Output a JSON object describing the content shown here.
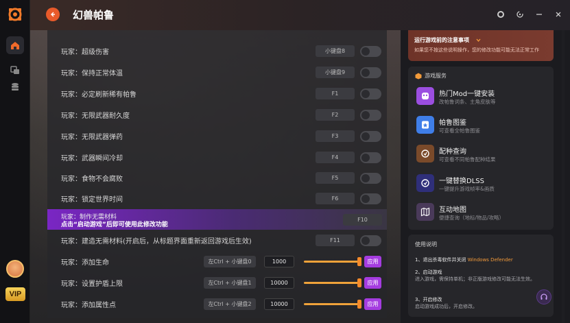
{
  "app": {
    "title": "幻兽帕鲁"
  },
  "colors": {
    "accent": "#e85a2a",
    "apply": "#a53ce0",
    "slider": "#f0a23a",
    "highlight": "#7a26c4"
  },
  "cheats": [
    {
      "label": "玩家：超级伤害",
      "key": "小键盘8"
    },
    {
      "label": "玩家：保持正常体温",
      "key": "小键盘9"
    },
    {
      "label": "玩家：必定刷新稀有帕鲁",
      "key": "F1"
    },
    {
      "label": "玩家：无限武器耐久度",
      "key": "F2"
    },
    {
      "label": "玩家：无限武器弹药",
      "key": "F3"
    },
    {
      "label": "玩家：武器瞬间冷却",
      "key": "F4"
    },
    {
      "label": "玩家：食物不会腐败",
      "key": "F5"
    },
    {
      "label": "玩家：锁定世界时间",
      "key": "F6"
    }
  ],
  "highlighted": {
    "label": "玩家：制作无需材料",
    "notice": "点击“启动游戏”后即可使用此修改功能",
    "key": "F10"
  },
  "build_row": {
    "label": "玩家：建造无需材料(开启后，从标题界面重新返回游戏后生效)",
    "key": "F11"
  },
  "value_rows": [
    {
      "label": "玩家：添加生命",
      "combo": "左Ctrl + 小键盘0",
      "value": "1000",
      "apply": "应用",
      "level": 1.0
    },
    {
      "label": "玩家：设置护盾上限",
      "combo": "左Ctrl + 小键盘1",
      "value": "10000",
      "apply": "应用",
      "level": 1.0
    },
    {
      "label": "玩家：添加属性点",
      "combo": "左Ctrl + 小键盘2",
      "value": "10000",
      "apply": "应用",
      "level": 1.0
    }
  ],
  "warning": {
    "title": "运行游戏前的注意事项",
    "desc": "如果您不按这些说明操作，您的修改功能可能无法正常工作"
  },
  "services": {
    "header": "游戏服务",
    "items": [
      {
        "name": "热门Mod一键安装",
        "sub": "改帕鲁词条、主角皮肤等",
        "icon": "mod-icon",
        "color": "#9b4ee0"
      },
      {
        "name": "帕鲁图鉴",
        "sub": "可查看全帕鲁图鉴",
        "icon": "book-icon",
        "color": "#3f7ee8"
      },
      {
        "name": "配种查询",
        "sub": "可查看不同帕鲁配种结果",
        "icon": "breed-icon",
        "color": "#7a4a2a"
      },
      {
        "name": "一键替换DLSS",
        "sub": "一键提升游戏帧率&画质",
        "icon": "dlss-icon",
        "color": "#3a3a8a"
      },
      {
        "name": "互动地图",
        "sub": "便捷查询（地标/物品/攻略）",
        "icon": "map-icon",
        "color": "#4a3a5a"
      }
    ]
  },
  "guide": {
    "header": "使用说明",
    "step1": "1、退出杀毒软件并关闭",
    "step1_hl": "Windows Defender",
    "step2": "2、启动游戏",
    "step2_desc": "进入游戏，需保持单机；非正版游戏修改可能无法生效。",
    "step3": "3、开启修改",
    "step3_desc": "启动游戏成功后，开启修改。"
  },
  "rail": {
    "vip": "VIP"
  }
}
